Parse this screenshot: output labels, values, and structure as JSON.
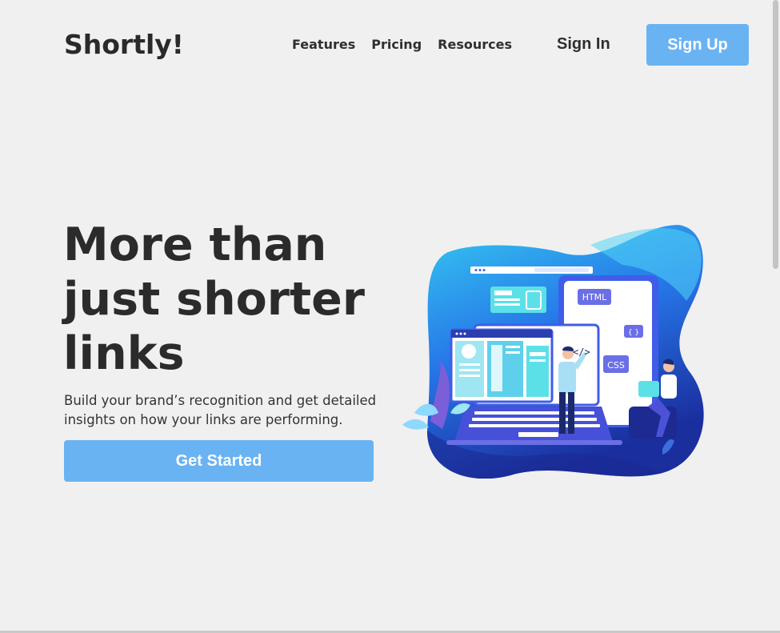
{
  "header": {
    "logo": "Shortly!",
    "nav": [
      {
        "label": "Features"
      },
      {
        "label": "Pricing"
      },
      {
        "label": "Resources"
      }
    ],
    "sign_in": "Sign In",
    "sign_up": "Sign Up"
  },
  "hero": {
    "headline_lines": [
      "More than",
      "just shorter",
      "links"
    ],
    "subtext": "Build your brand’s recognition and get detailed insights on how your links are performing.",
    "cta": "Get Started",
    "illustration": {
      "labels": [
        "HTML",
        "{ }",
        "CSS"
      ],
      "accent": "#3f5de8",
      "blob_color": "#2b6ef2"
    }
  },
  "theme": {
    "button_color": "#69b3f2",
    "background": "#f0f0f0",
    "text_dark": "#2b2b2b"
  }
}
